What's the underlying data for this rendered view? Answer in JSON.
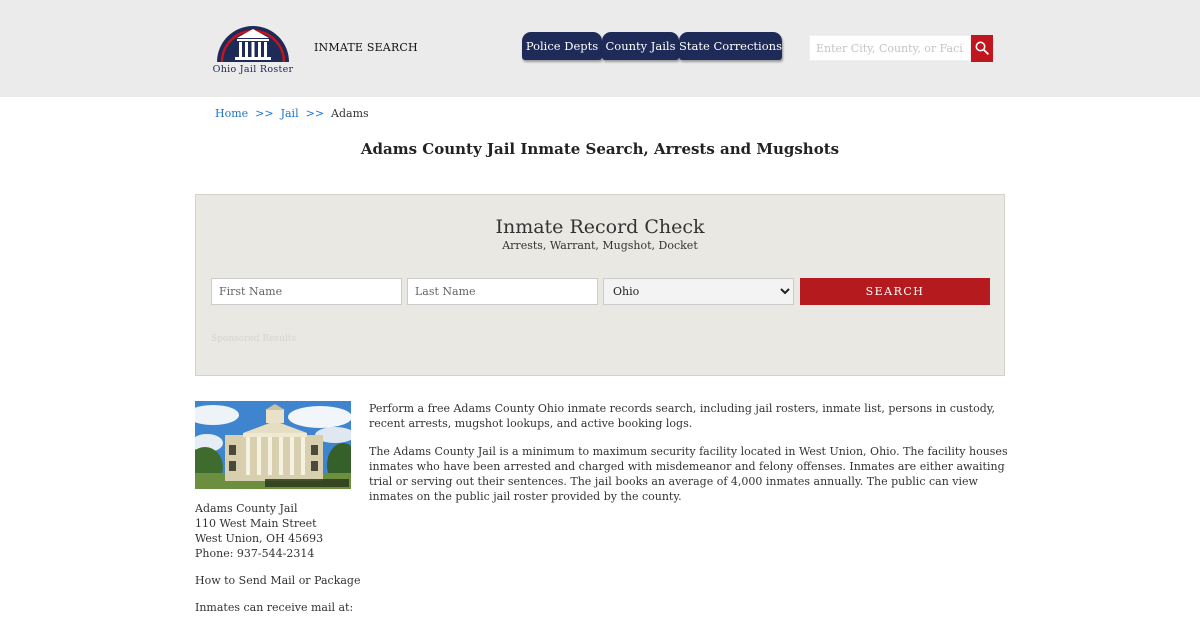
{
  "header": {
    "logo_text": "Ohio Jail Roster",
    "search_link": "INMATE SEARCH",
    "tabs": [
      {
        "label": "Police Depts"
      },
      {
        "label": "County Jails"
      },
      {
        "label": "State Corrections"
      }
    ],
    "search": {
      "placeholder": "Enter City, County, or Facility",
      "value": "",
      "icon": "search-icon"
    }
  },
  "breadcrumb": {
    "home": "Home",
    "jail": "Jail",
    "separator": ">>",
    "current": "Adams"
  },
  "page_title": "Adams County Jail Inmate Search, Arrests and Mugshots",
  "record_check": {
    "title": "Inmate Record Check",
    "subtitle": "Arrests, Warrant, Mugshot, Docket",
    "first_name_placeholder": "First Name",
    "last_name_placeholder": "Last Name",
    "state_selected": "Ohio",
    "submit_label": "SEARCH",
    "sponsored_text": "Sponsored Results"
  },
  "facility": {
    "name": "Adams County Jail",
    "street": "110 West Main Street",
    "city_state_zip": "West Union, OH 45693",
    "phone": "Phone: 937-544-2314",
    "mail_heading": "How to Send Mail or Package",
    "mail_note": "Inmates can receive mail at:"
  },
  "intro": {
    "paragraph1": "Perform a free Adams County Ohio inmate records search, including jail rosters, inmate list, persons in custody, recent arrests, mugshot lookups, and active booking logs.",
    "paragraph2": "The Adams County Jail is a minimum to maximum security facility located in West Union, Ohio. The facility houses inmates who have been arrested and charged with misdemeanor and felony offenses. Inmates are either awaiting trial or serving out their sentences. The jail books an average of 4,000 inmates annually. The public can view inmates on the public jail roster provided by the county."
  },
  "colors": {
    "header_bg": "#ebebeb",
    "nav_tab": "#1e2a57",
    "accent_red": "#b51b1e",
    "link_blue": "#1e73c8",
    "panel_bg": "#e9e8e3"
  }
}
